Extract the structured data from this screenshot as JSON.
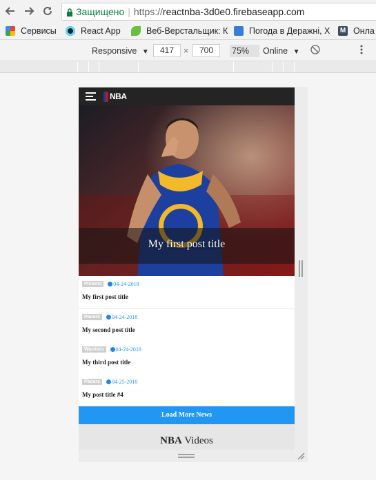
{
  "browser": {
    "secure_label": "Защищено",
    "url_proto": "https://",
    "url_host": "reactnba-3d0e0.firebaseapp.com",
    "bookmarks": [
      {
        "label": "Сервисы",
        "icon": "apps-grid-icon"
      },
      {
        "label": "React App",
        "icon": "react-icon"
      },
      {
        "label": "Веб-Верстальщик: К",
        "icon": "leaf-icon"
      },
      {
        "label": "Погода в Деражні, Х",
        "icon": "weather-icon"
      },
      {
        "label": "Онла",
        "icon": "m-icon"
      }
    ]
  },
  "device_toolbar": {
    "mode": "Responsive",
    "width": "417",
    "times": "×",
    "height": "700",
    "zoom": "75%",
    "network": "Online"
  },
  "app": {
    "brand": "NBA",
    "hero_title": "My first post title",
    "posts": [
      {
        "team": "Pistons",
        "date": "04-24-2018",
        "title": "My first post title"
      },
      {
        "team": "Pacers",
        "date": "04-24-2018",
        "title": "My second post title"
      },
      {
        "team": "Warriors",
        "date": "04-24-2018",
        "title": "My third post title"
      },
      {
        "team": "Pacers",
        "date": "04-25-2018",
        "title": "My post title #4"
      }
    ],
    "load_more": "Load More News",
    "videos_brand": "NBA",
    "videos_label": " Videos"
  },
  "colors": {
    "accent": "#2196f3",
    "header": "#242424",
    "secure_green": "#0b8043"
  }
}
